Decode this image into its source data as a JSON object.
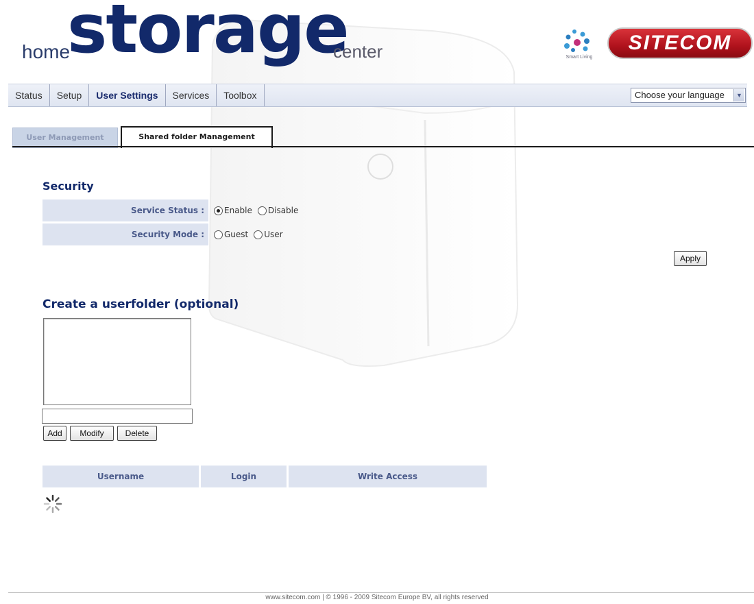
{
  "header": {
    "logo_home": "home",
    "logo_storage": "storage",
    "logo_center": "center",
    "partner_tagline": "Smart Living",
    "brand": "SITECOM"
  },
  "nav": {
    "items": [
      {
        "label": "Status",
        "active": false
      },
      {
        "label": "Setup",
        "active": false
      },
      {
        "label": "User Settings",
        "active": true
      },
      {
        "label": "Services",
        "active": false
      },
      {
        "label": "Toolbox",
        "active": false
      }
    ],
    "language_select": "Choose your language"
  },
  "tabs": {
    "user_management": "User Management",
    "shared_folder_management": "Shared folder Management"
  },
  "security": {
    "title": "Security",
    "service_status_label": "Service Status :",
    "service_status_options": [
      "Enable",
      "Disable"
    ],
    "service_status_selected": "Enable",
    "security_mode_label": "Security Mode :",
    "security_mode_options": [
      "Guest",
      "User"
    ],
    "security_mode_selected": "",
    "apply_label": "Apply"
  },
  "userfolder": {
    "title": "Create a userfolder (optional)",
    "folder_name_value": "",
    "add_label": "Add",
    "modify_label": "Modify",
    "delete_label": "Delete"
  },
  "table": {
    "columns": [
      "Username",
      "Login",
      "Write Access"
    ]
  },
  "footer": {
    "text": "www.sitecom.com | © 1996 - 2009 Sitecom Europe BV, all rights reserved"
  },
  "colors": {
    "brand_navy": "#12296a",
    "label_bg": "#dde3f0",
    "sitecom_red": "#b0121c"
  },
  "icons": {
    "spinner": "loading-spinner-icon",
    "language_arrow": "chevron-down-icon"
  }
}
